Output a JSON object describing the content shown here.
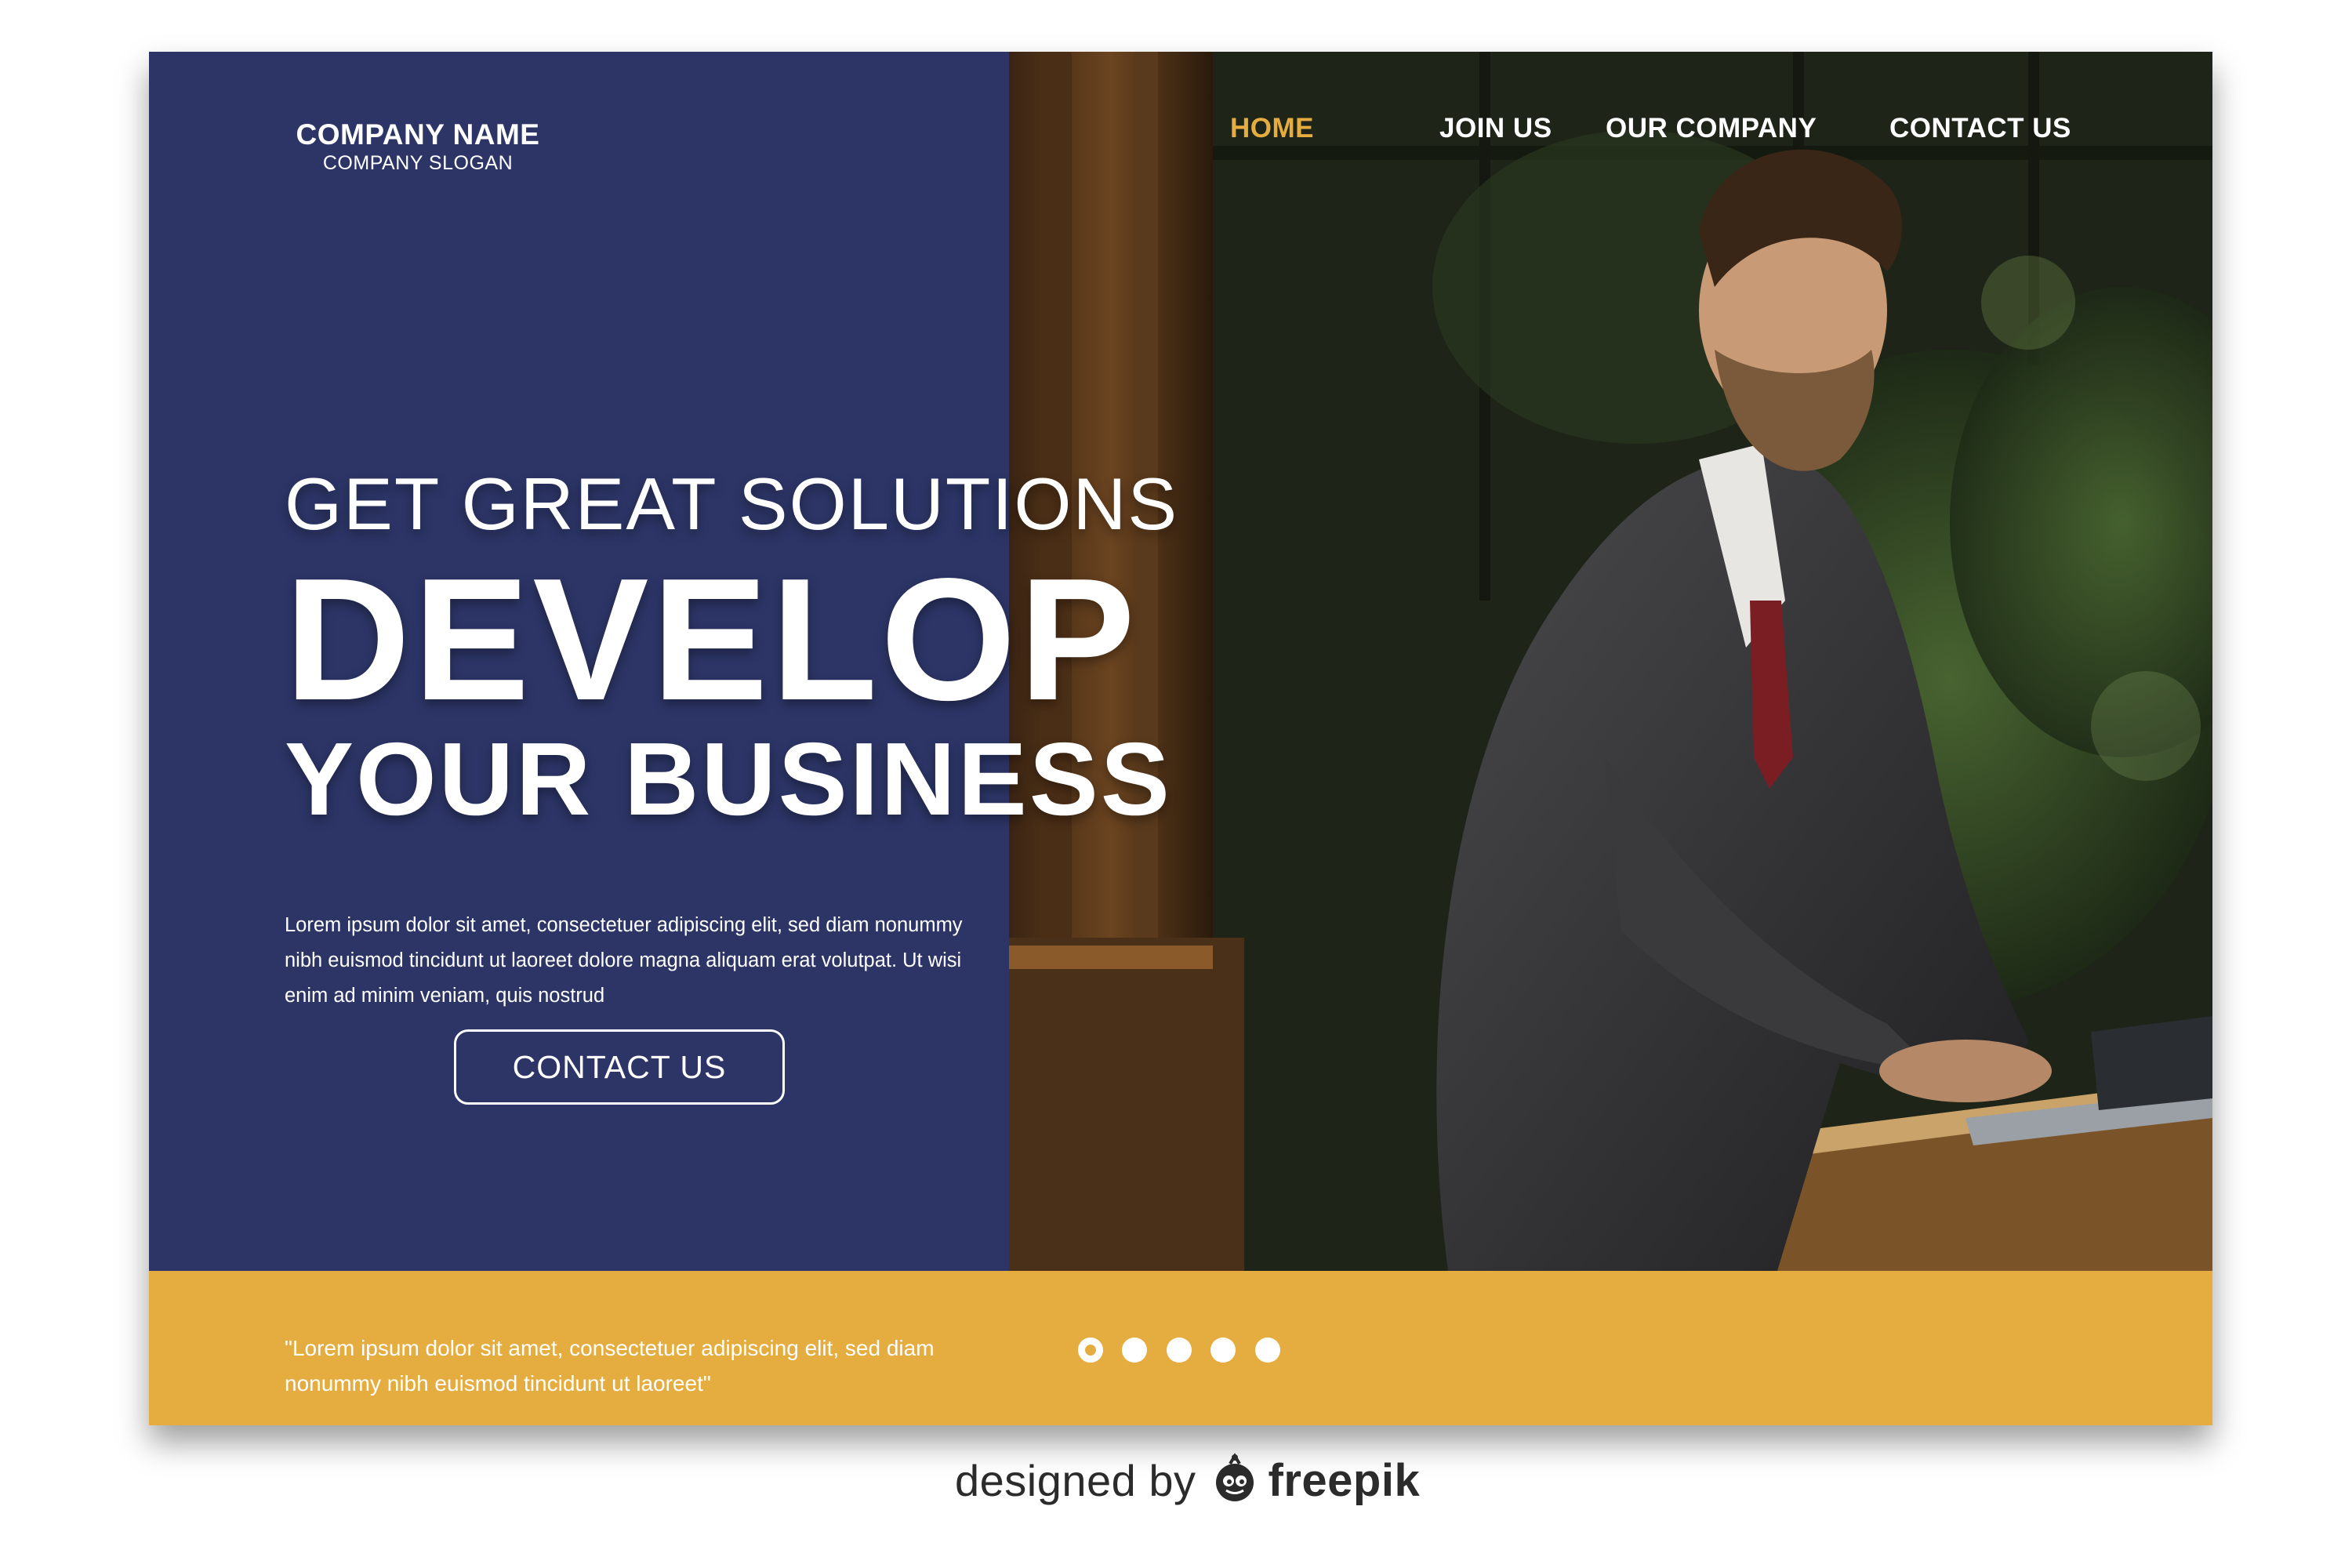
{
  "brand": {
    "name": "COMPANY NAME",
    "slogan": "COMPANY SLOGAN"
  },
  "nav": {
    "items": [
      {
        "label": "HOME",
        "active": true
      },
      {
        "label": "JOIN US",
        "active": false
      },
      {
        "label": "OUR COMPANY",
        "active": false
      },
      {
        "label": "CONTACT US",
        "active": false
      }
    ]
  },
  "hero": {
    "subtitle": "GET GREAT SOLUTIONS",
    "title": "DEVELOP",
    "title_line2": "YOUR BUSINESS",
    "body": "Lorem ipsum dolor sit amet, consectetuer adipiscing elit, sed diam nonummy nibh euismod tincidunt ut laoreet dolore magna aliquam erat volutpat. Ut wisi enim ad minim veniam, quis nostrud",
    "cta_label": "CONTACT US"
  },
  "footer": {
    "quote": "\"Lorem ipsum dolor sit amet, consectetuer adipiscing elit, sed diam nonummy nibh euismod tincidunt ut laoreet\"",
    "slider": {
      "count": 5,
      "active_index": 0
    }
  },
  "credit": {
    "text": "designed by",
    "brand": "freepik"
  },
  "colors": {
    "panel": "#2c3566",
    "accent": "#e5ad40",
    "nav_active": "#e5ac3f",
    "text": "#ffffff"
  },
  "icons": {
    "credit_logo": "freepik-logo-icon",
    "slider_dot": "dot-icon"
  }
}
